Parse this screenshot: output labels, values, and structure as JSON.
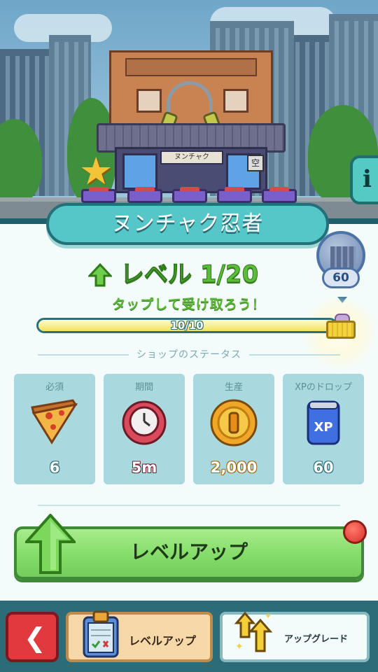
{
  "shop": {
    "name": "ヌンチャク忍者",
    "sign_text": "ヌンチャク",
    "kanji_sign": "空",
    "badge_value": "60"
  },
  "level": {
    "label": "レベル 1/20",
    "claim_text": "タップして受け取ろう！",
    "progress_text": "10/10",
    "progress_fraction": 1.0
  },
  "status": {
    "title": "ショップのステータス",
    "cards": [
      {
        "header": "必須",
        "value": "6",
        "icon": "pizza-icon",
        "value_color": "#ffffff"
      },
      {
        "header": "期間",
        "value": "5m",
        "icon": "clock-icon",
        "value_color": "#ffffff"
      },
      {
        "header": "生産",
        "value": "2,000",
        "icon": "coin-icon",
        "value_color": "#ffffff"
      },
      {
        "header": "XPのドロップ",
        "value": "60",
        "icon": "xp-can-icon",
        "value_color": "#ffffff"
      }
    ]
  },
  "actions": {
    "level_up_button": "レベルアップ"
  },
  "bottom": {
    "tab_levelup": "レベルアップ",
    "tab_upgrade": "アップグレード"
  },
  "colors": {
    "accent_teal": "#56c7c8",
    "level_green": "#5dbb3a",
    "button_green": "#84dc6a",
    "back_red": "#e2393f",
    "panel_bg": "#f3fbfb"
  }
}
